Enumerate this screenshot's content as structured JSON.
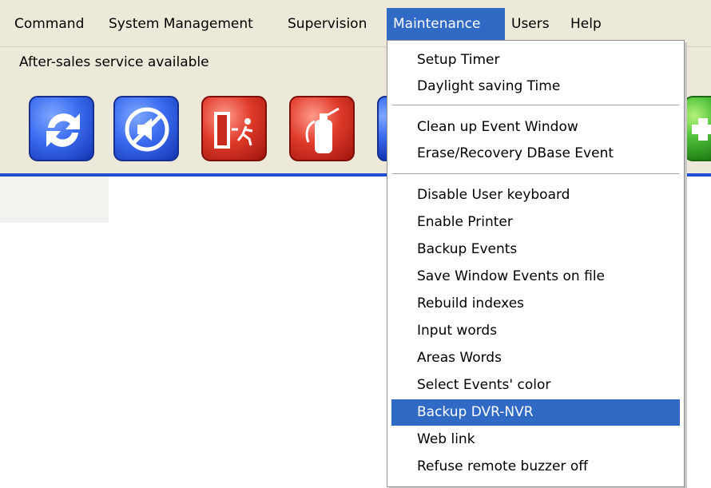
{
  "menubar": {
    "items": [
      {
        "label": "Command"
      },
      {
        "label": "System Management"
      },
      {
        "label": "Supervision"
      },
      {
        "label": "Maintenance"
      },
      {
        "label": "Users"
      },
      {
        "label": "Help"
      }
    ],
    "active": "Maintenance"
  },
  "status": {
    "text": "After-sales service available"
  },
  "toolbar": {
    "buttons": [
      {
        "icon": "refresh-icon",
        "color": "#2f5fe6"
      },
      {
        "icon": "speaker-mute-icon",
        "color": "#2f5fe6"
      },
      {
        "icon": "emergency-exit-icon",
        "color": "#d93224"
      },
      {
        "icon": "fire-extinguisher-icon",
        "color": "#d93224"
      },
      {
        "icon": "add-icon",
        "color": "#4fc23a"
      }
    ]
  },
  "maintenance_menu": {
    "items": [
      {
        "label": "Setup Timer"
      },
      {
        "label": "Daylight saving Time"
      },
      {
        "label": "Clean up Event Window"
      },
      {
        "label": "Erase/Recovery DBase Event"
      },
      {
        "label": "Disable User keyboard"
      },
      {
        "label": "Enable Printer"
      },
      {
        "label": "Backup Events"
      },
      {
        "label": "Save Window Events on file"
      },
      {
        "label": "Rebuild indexes"
      },
      {
        "label": "Input words"
      },
      {
        "label": "Areas Words"
      },
      {
        "label": "Select Events' color"
      },
      {
        "label": "Backup DVR-NVR"
      },
      {
        "label": "Web link"
      },
      {
        "label": "Refuse remote  buzzer off"
      }
    ],
    "highlighted": "Backup DVR-NVR"
  },
  "colors": {
    "menu_bg": "#ece9d8",
    "selection": "#316ac5",
    "toolbar_border": "#1f4fd0"
  }
}
